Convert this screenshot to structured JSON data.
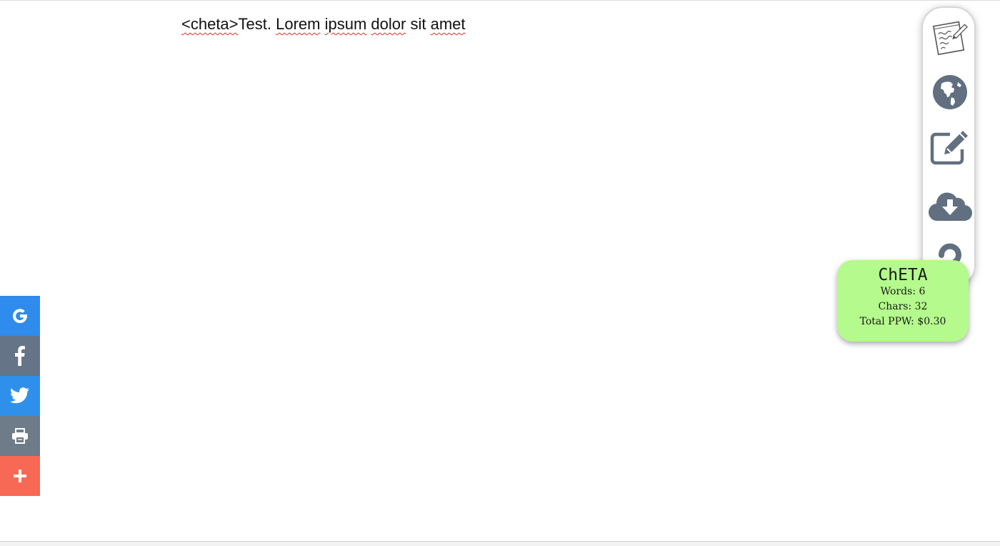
{
  "document": {
    "tag": "<cheta>",
    "words": [
      "Test.",
      "Lorem",
      "ipsum",
      "dolor",
      "sit",
      "amet"
    ]
  },
  "toolbar": {
    "items": [
      {
        "name": "notepad-icon"
      },
      {
        "name": "globe-icon"
      },
      {
        "name": "edit-icon"
      },
      {
        "name": "cloud-download-icon"
      },
      {
        "name": "help-icon"
      }
    ],
    "icon_color": "#617080"
  },
  "stats": {
    "title": "ChETA",
    "words_line": "Words: 6",
    "chars_line": "Chars: 32",
    "ppw_line": "Total PPW: $0.30",
    "background": "#b4fa8c"
  },
  "share": {
    "buttons": [
      {
        "name": "google-icon",
        "color": "#2f8bec"
      },
      {
        "name": "facebook-icon",
        "color": "#667487"
      },
      {
        "name": "twitter-icon",
        "color": "#2f90ec"
      },
      {
        "name": "print-icon",
        "color": "#6e7b88"
      },
      {
        "name": "plus-icon",
        "color": "#f76955"
      }
    ]
  }
}
